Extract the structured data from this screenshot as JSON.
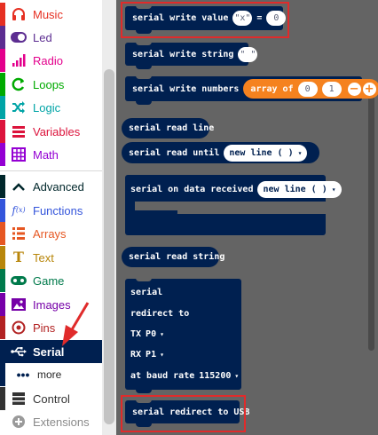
{
  "sidebar": {
    "categories": [
      {
        "label": "Music",
        "color": "#e63022",
        "icon": "headphones-icon"
      },
      {
        "label": "Led",
        "color": "#5c2d91",
        "icon": "toggle-icon"
      },
      {
        "label": "Radio",
        "color": "#e3008c",
        "icon": "signal-bars-icon"
      },
      {
        "label": "Loops",
        "color": "#00aa00",
        "icon": "loop-arrow-icon"
      },
      {
        "label": "Logic",
        "color": "#00a4a6",
        "icon": "shuffle-icon"
      },
      {
        "label": "Variables",
        "color": "#dc143c",
        "icon": "list-lines-icon"
      },
      {
        "label": "Math",
        "color": "#9400d3",
        "icon": "calculator-grid-icon"
      },
      {
        "label": "Advanced",
        "color": "#00272b",
        "icon": "chevron-up-icon"
      },
      {
        "label": "Functions",
        "color": "#3455db",
        "icon": "function-icon"
      },
      {
        "label": "Arrays",
        "color": "#e65722",
        "icon": "list-bars-icon"
      },
      {
        "label": "Text",
        "color": "#b8860b",
        "icon": "text-t-icon"
      },
      {
        "label": "Game",
        "color": "#007a4b",
        "icon": "gamepad-icon"
      },
      {
        "label": "Images",
        "color": "#7600a8",
        "icon": "image-icon"
      },
      {
        "label": "Pins",
        "color": "#b22222",
        "icon": "target-icon"
      },
      {
        "label": "Serial",
        "color": "#002050",
        "icon": "usb-icon"
      },
      {
        "label": "more",
        "color": "#002050",
        "icon": "dots-icon"
      },
      {
        "label": "Control",
        "color": "#333333",
        "icon": "layers-icon"
      },
      {
        "label": "Extensions",
        "color": "#9a9a9a",
        "icon": "plus-circle-icon"
      }
    ]
  },
  "flyout": {
    "write_value": {
      "text": "serial write value",
      "name": "\"x\"",
      "eq": "=",
      "value": "0"
    },
    "write_string": {
      "text": "serial write string",
      "value": "\" \""
    },
    "write_numbers": {
      "text": "serial write numbers",
      "array_label": "array of",
      "v1": "0",
      "v2": "1",
      "minus": "−",
      "plus": "+"
    },
    "read_line": {
      "text": "serial read line"
    },
    "read_until": {
      "text": "serial read until",
      "option": "new line ( )"
    },
    "on_data_received": {
      "text": "serial on data received",
      "option": "new line ( )"
    },
    "read_string": {
      "text": "serial read string"
    },
    "redirect": {
      "title": "serial",
      "line2": "redirect to",
      "tx_label": "TX",
      "tx_value": "P0",
      "rx_label": "RX",
      "rx_value": "P1",
      "baud_label": "at baud rate",
      "baud_value": "115200"
    },
    "redirect_usb": {
      "text": "serial redirect to USB"
    },
    "dropdown_caret": "▾"
  },
  "colors": {
    "block": "#002050",
    "flyout_bg": "#646464",
    "array_block": "#f5821f",
    "highlight": "#e02b2b"
  }
}
